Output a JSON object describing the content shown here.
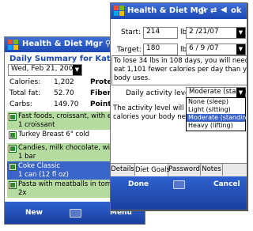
{
  "back_window": {
    "title": "Health & Diet Mgr",
    "summary_title": "Daily Summary for Katherine",
    "date": "Wed, Feb 21, 2007",
    "nutrition": {
      "calories_label": "Calories:",
      "calories": "1,202",
      "protein_label": "Protein",
      "total_fat_label": "Total fat:",
      "total_fat": "52.70",
      "fiber_label": "Fiber:",
      "carbs_label": "Carbs:",
      "carbs": "149.70",
      "points_label": "Points:"
    },
    "foods": [
      {
        "line1": "Fast foods, croissant, with e...",
        "line2": "1 croissant",
        "highlighted": true
      },
      {
        "line1": "Turkey Breast 6\" cold",
        "line2": "",
        "highlighted": false
      },
      {
        "line1": "Candies, milk chocolate, with ...",
        "line2": "1 bar",
        "highlighted": true
      },
      {
        "line1": "Coke Classic",
        "line2": "1 can (12 fl oz)",
        "highlighted": false,
        "selected": true
      },
      {
        "line1": "Pasta with meatballs in tomato...",
        "line2": "2x",
        "highlighted": true
      }
    ],
    "softkeys": {
      "left": "New",
      "right": "Menu"
    }
  },
  "front_window": {
    "title": "Health & Diet Mgr",
    "ok": "ok",
    "start_label": "Start:",
    "start_value": "214",
    "start_unit": "lbs",
    "start_date": "2 /21/07",
    "target_label": "Target:",
    "target_value": "180",
    "target_unit": "lbs",
    "target_date": "6 / 9 /07",
    "info_lines": [
      "To lose 34 lbs in 108 days, you will need to",
      "eat 1,101 fewer calories per day than your",
      "body uses."
    ],
    "activity_label": "Daily activity level:",
    "activity_value": "Moderate (standi",
    "activity_options": [
      "None (sleep)",
      "Light (sitting)",
      "Moderate (standing)",
      "Heavy (lifting)"
    ],
    "desc_lines": [
      "The activity level will dete",
      "calories your body needs"
    ],
    "tabs": [
      "Details",
      "Diet Goals",
      "Password",
      "Notes"
    ],
    "active_tab": "Diet Goals",
    "softkeys": {
      "left": "Done",
      "right": "Cancel"
    }
  }
}
